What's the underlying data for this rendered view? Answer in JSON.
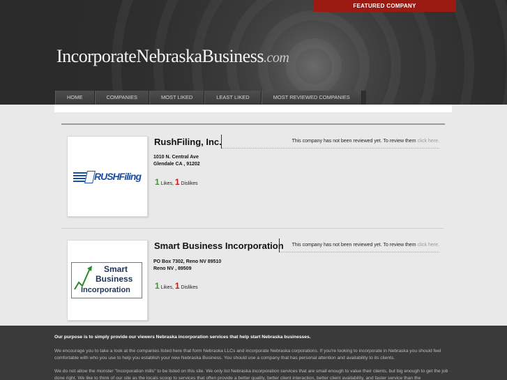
{
  "featured_label": "FEATURED COMPANY",
  "logo": {
    "main": "IncorporateNebraskaBusiness",
    "domain": ".com"
  },
  "nav": [
    "HOME",
    "COMPANIES",
    "MOST LIKED",
    "LEAST LIKED",
    "MOST REVIEWED COMPANIES"
  ],
  "companies": [
    {
      "name": "RushFiling, Inc.",
      "logo_text": "RUSHFiling",
      "review_text": "This company has not been reviewed yet. To review them ",
      "review_link": "click here.",
      "address1": "1010 N. Central Ave",
      "address2": "Glendale  CA , 91202",
      "likes": "1",
      "likes_label": " Likes, ",
      "dislikes": "1",
      "dislikes_label": " Dislikes"
    },
    {
      "name": "Smart Business Incorporation",
      "logo_line1": "Smart",
      "logo_line2": "Business",
      "logo_line3": "Incorporation",
      "review_text": "This company has not been reviewed yet. To review them ",
      "review_link": "click here.",
      "address1": "PO Box 7302, Reno NV 89510",
      "address2": "Reno  NV , 89509",
      "likes": "1",
      "likes_label": " Likes, ",
      "dislikes": "1",
      "dislikes_label": " Dislikes"
    }
  ],
  "footer": {
    "p1": "Our purpose is to simply provide our viewers Nebraska incorporation services that help start Nebraska businesses.",
    "p2": "We encourage you to take a look at the companies listed here that form Nebraska LLCs and incorporate Nebraska corporations. If you're looking to incorporate in Nebraska you should feel comfortable with who you use to help you establish your new Nebraska Business. You should use a company that has personal attention and availability to its clients.",
    "p3": "We do not allow the monster \"Incorporation mills\" to be listed on this site. We only list Nebraska incorporation services that are small enough to value their clients, but big enough to get the job done right. We like to think of our site as the locals scoop to services that often provide a better quality, better client interaction, better client availability, and faster service than the"
  }
}
